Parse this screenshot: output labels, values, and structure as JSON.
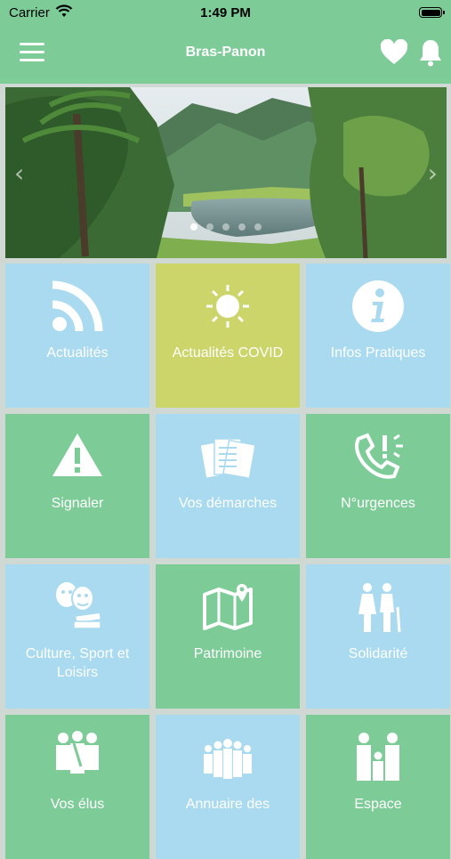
{
  "status_bar": {
    "carrier": "Carrier",
    "time": "1:49 PM"
  },
  "header": {
    "title": "Bras-Panon"
  },
  "icons": {
    "menu": "hamburger-icon",
    "favorite": "heart-icon",
    "notifications": "bell-icon",
    "prev": "chevron-left-icon",
    "next": "chevron-right-icon"
  },
  "carousel": {
    "slide_count": 5,
    "active_index": 0
  },
  "colors": {
    "green": "#7dcc98",
    "blue": "#a9daf0",
    "olive": "#cbd56a"
  },
  "tiles": [
    {
      "label": "Actualités",
      "icon": "rss-icon",
      "color": "blue"
    },
    {
      "label": "Actualités COVID",
      "icon": "sun-icon",
      "color": "olive"
    },
    {
      "label": "Infos Pratiques",
      "icon": "info-icon",
      "color": "blue"
    },
    {
      "label": "Signaler",
      "icon": "warning-icon",
      "color": "green"
    },
    {
      "label": "Vos démarches",
      "icon": "documents-icon",
      "color": "blue"
    },
    {
      "label": "N°urgences",
      "icon": "emergency-phone-icon",
      "color": "green"
    },
    {
      "label": "Culture, Sport et Loisirs",
      "icon": "theater-masks-icon",
      "color": "blue"
    },
    {
      "label": "Patrimoine",
      "icon": "map-icon",
      "color": "green"
    },
    {
      "label": "Solidarité",
      "icon": "elderly-couple-icon",
      "color": "blue"
    },
    {
      "label": "Vos élus",
      "icon": "officials-icon",
      "color": "green"
    },
    {
      "label": "Annuaire des",
      "icon": "group-icon",
      "color": "blue"
    },
    {
      "label": "Espace",
      "icon": "family-icon",
      "color": "green"
    }
  ]
}
